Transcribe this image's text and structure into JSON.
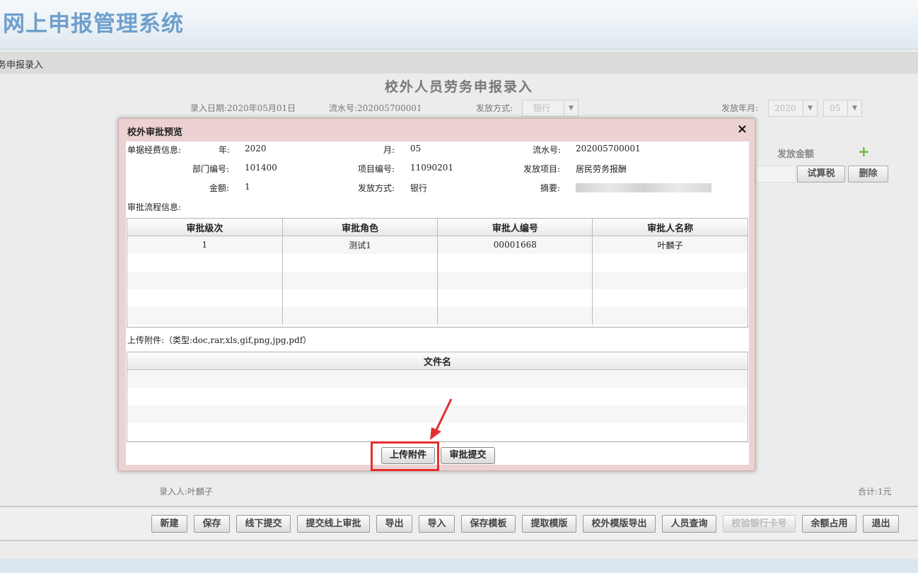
{
  "app_title": "网上申报管理系统",
  "breadcrumb": "务申报录入",
  "page_title": "校外人员劳务申报录入",
  "form": {
    "entry_date": "录入日期:2020年05月01日",
    "serial": "流水号:202005700001",
    "pay_method_label": "发放方式:",
    "pay_method_value": "银行",
    "pay_month_label": "发放年月:",
    "year_value": "2020",
    "month_value": "05",
    "amount_header": "发放金额",
    "calc_tax_button": "试算税",
    "delete_button": "删除",
    "entered_by": "录入人:叶麟子",
    "total": "合计:1元"
  },
  "modal": {
    "title": "校外审批预览",
    "close": "×",
    "bill_info_label": "单据经费信息:",
    "year_label": "年:",
    "year_value": "2020",
    "month_label": "月:",
    "month_value": "05",
    "serial_label": "流水号:",
    "serial_value": "202005700001",
    "dept_label": "部门编号:",
    "dept_value": "101400",
    "project_label": "项目编号:",
    "project_value": "11090201",
    "item_label": "发放项目:",
    "item_value": "居民劳务报酬",
    "amount_label": "金额:",
    "amount_value": "1",
    "method_label": "发放方式:",
    "method_value": "银行",
    "summary_label": "摘要:",
    "flow_label": "审批流程信息:",
    "approval_headers": [
      "审批级次",
      "审批角色",
      "审批人编号",
      "审批人名称"
    ],
    "approval_rows": [
      [
        "1",
        "测试1",
        "00001668",
        "叶麟子"
      ]
    ],
    "attachment_label": "上传附件:（类型:doc,rar,xls,gif,png,jpg,pdf）",
    "file_header": "文件名",
    "upload_button": "上传附件",
    "submit_button": "审批提交"
  },
  "toolbar": {
    "buttons": [
      "新建",
      "保存",
      "线下提交",
      "提交线上审批",
      "导出",
      "导入",
      "保存模板",
      "提取模版",
      "校外模版导出",
      "人员查询",
      "校验银行卡号",
      "余额占用",
      "退出"
    ]
  },
  "colors": {
    "title_blue": "#6f9fcb",
    "modal_bg": "#ecd2d2",
    "highlight_red": "#e23030"
  }
}
